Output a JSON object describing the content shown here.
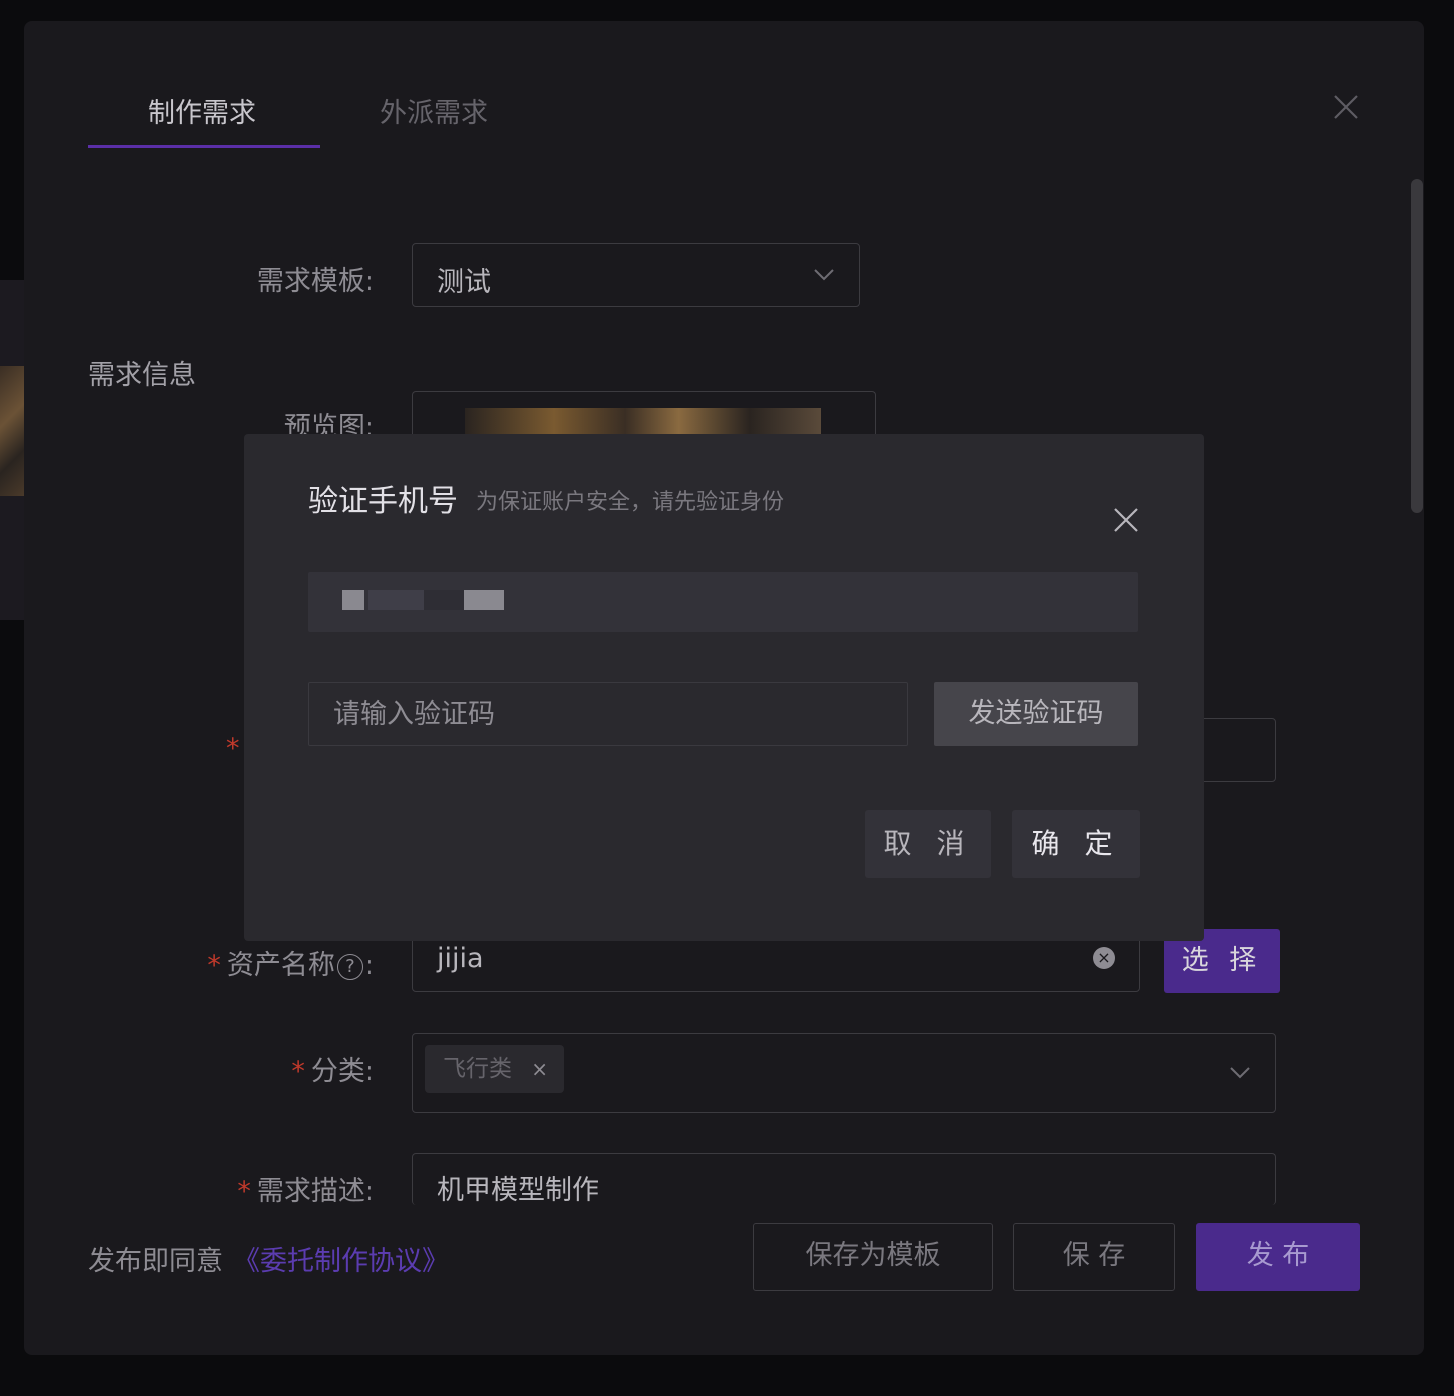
{
  "tabs": {
    "active": "制作需求",
    "inactive": "外派需求"
  },
  "form": {
    "template_label": "需求模板:",
    "template_value": "测试",
    "section_title": "需求信息",
    "preview_label": "预览图:",
    "asset_label": "资产名称",
    "asset_value": "jijia",
    "select_button": "选 择",
    "category_label": "分类:",
    "category_tag": "飞行类",
    "desc_label": "需求描述:",
    "desc_value": "机甲模型制作",
    "required_mark": "*",
    "colon": ":",
    "help_glyph": "?",
    "clear_glyph": "×",
    "tag_remove_glyph": "×"
  },
  "footer": {
    "agree_prefix": "发布即同意",
    "agree_link": "《委托制作协议》",
    "save_template": "保存为模板",
    "save": "保 存",
    "publish": "发 布"
  },
  "modal": {
    "title": "验证手机号",
    "subtitle": "为保证账户安全，请先验证身份",
    "code_placeholder": "请输入验证码",
    "send_code": "发送验证码",
    "cancel": "取 消",
    "confirm": "确 定"
  },
  "colors": {
    "accent": "#4a2a8c",
    "required": "#c0392b",
    "link": "#5b3cb0"
  }
}
